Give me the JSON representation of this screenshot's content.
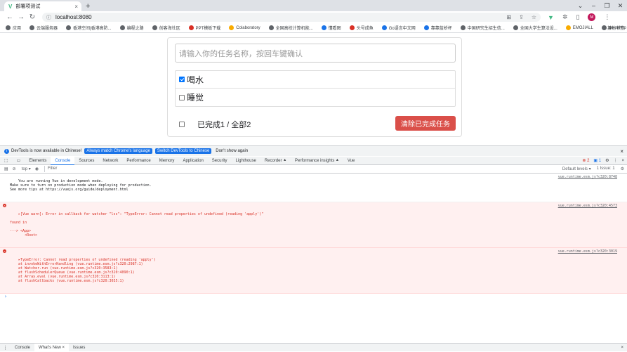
{
  "browser": {
    "tab_title": "部署项测试",
    "url": "localhost:8080",
    "profile_initial": "M"
  },
  "bookmarks": {
    "items": [
      "应用",
      "云端服务器",
      "香港空间|香港高防...",
      "编程之路",
      "创客海社区",
      "PPT模板下载",
      "Colaboratory",
      "全国高校计算机能...",
      "懂看图",
      "头号成鱼",
      "Go语言中文网",
      "靠靠蓝桥杯",
      "中国研究生招生信...",
      "全国大学生算法设...",
      "EMOJIALL",
      "go-cqhttp"
    ],
    "more": "»",
    "other": "其他书签"
  },
  "todo": {
    "input_placeholder": "请输入你的任务名称，按回车键确认",
    "items": [
      {
        "label": "喝水",
        "done": true
      },
      {
        "label": "睡觉",
        "done": false
      }
    ],
    "footer_text": "已完成1 / 全部2",
    "clear_button": "清除已完成任务"
  },
  "infobar": {
    "text": "DevTools is now available in Chinese!",
    "btn1": "Always match Chrome's language",
    "btn2": "Switch DevTools to Chinese",
    "link": "Don't show again"
  },
  "devtools": {
    "tabs": [
      "Elements",
      "Console",
      "Sources",
      "Network",
      "Performance",
      "Memory",
      "Application",
      "Security",
      "Lighthouse",
      "Recorder ⯅",
      "Performance insights ⯅",
      "Vue"
    ],
    "error_badge": "2",
    "issue_badge": "1",
    "context": "top ▾",
    "filter_placeholder": "Filter",
    "levels": "Default levels ▾",
    "issues": "1 Issue: 1"
  },
  "console": {
    "messages": [
      {
        "type": "info",
        "text": "You are running Vue in development mode.\nMake sure to turn on production mode when deploying for production.\nSee more tips at https://vuejs.org/guide/deployment.html",
        "source": "vue.runtime.esm.js?c320:8748"
      },
      {
        "type": "error",
        "text": "▸[Vue warn]: Error in callback for watcher \"lss\": \"TypeError: Cannot read properties of undefined (reading 'apply')\"\n\nfound in\n\n---> <App>\n       <Root>",
        "source": "vue.runtime.esm.js?c320:4573"
      },
      {
        "type": "error",
        "text": "▸TypeError: Cannot read properties of undefined (reading 'apply')\n    at invokeWithErrorHandling (vue.runtime.esm.js?c320:2987:1)\n    at Watcher.run (vue.runtime.esm.js?c320:3583:1)\n    at flushSchedulerQueue (vue.runtime.esm.js?c320:4090:1)\n    at Array.eval (vue.runtime.esm.js?c320:3113:1)\n    at flushCallbacks (vue.runtime.esm.js?c320:3035:1)",
        "source": "vue.runtime.esm.js?c320:3019"
      }
    ],
    "prompt": "›"
  },
  "drawer": {
    "tabs": [
      "Console",
      "What's New ×",
      "Issues"
    ]
  }
}
